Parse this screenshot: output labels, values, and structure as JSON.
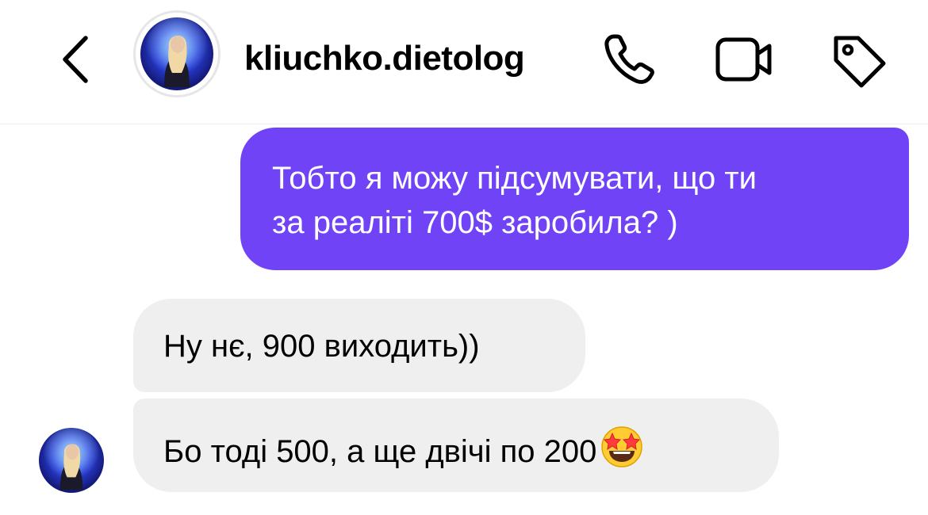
{
  "header": {
    "back_icon": "chevron-left-icon",
    "username": "kliuchko.dietolog",
    "actions": [
      {
        "icon": "phone-icon"
      },
      {
        "icon": "video-camera-icon"
      },
      {
        "icon": "tag-icon"
      }
    ]
  },
  "messages": [
    {
      "direction": "outgoing",
      "lines": [
        "Тобто я можу підсумувати, що ти",
        "за реаліті 700$ заробила? )"
      ]
    },
    {
      "direction": "incoming",
      "text": "Ну нє, 900 виходить))"
    },
    {
      "direction": "incoming",
      "text": "Бо тоді 500, а ще двічі по 200",
      "emoji": "star-struck-emoji"
    }
  ],
  "colors": {
    "outgoing_bubble": "#7044f6",
    "incoming_bubble": "#efefef",
    "outgoing_text": "#ffffff",
    "incoming_text": "#000000"
  }
}
